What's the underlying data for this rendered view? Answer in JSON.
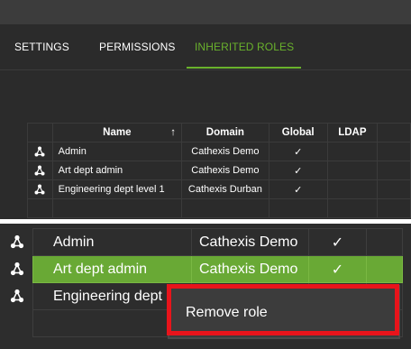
{
  "tabs": [
    {
      "label": "SETTINGS",
      "active": false
    },
    {
      "label": "PERMISSIONS",
      "active": false
    },
    {
      "label": "INHERITED ROLES",
      "active": true
    }
  ],
  "grid": {
    "columns": [
      "Name",
      "Domain",
      "Global",
      "LDAP"
    ],
    "sort_indicator": "↑",
    "rows": [
      {
        "name": "Admin",
        "domain": "Cathexis Demo",
        "global": "✓",
        "ldap": ""
      },
      {
        "name": "Art dept admin",
        "domain": "Cathexis Demo",
        "global": "✓",
        "ldap": ""
      },
      {
        "name": "Engineering dept level 1",
        "domain": "Cathexis Durban",
        "global": "✓",
        "ldap": ""
      }
    ]
  },
  "zoom": {
    "rows": [
      {
        "name": "Admin",
        "domain": "Cathexis Demo",
        "global": "✓",
        "selected": false
      },
      {
        "name": "Art dept admin",
        "domain": "Cathexis Demo",
        "global": "✓",
        "selected": true
      },
      {
        "name": "Engineering dept l",
        "domain": "",
        "global": "",
        "selected": false
      }
    ]
  },
  "context_menu": {
    "remove_role": "Remove role"
  },
  "colors": {
    "accent": "#6ab22c",
    "highlight": "#e8141b",
    "selected_row": "#69a935"
  },
  "icons": {
    "row": "role-tree-icon"
  }
}
